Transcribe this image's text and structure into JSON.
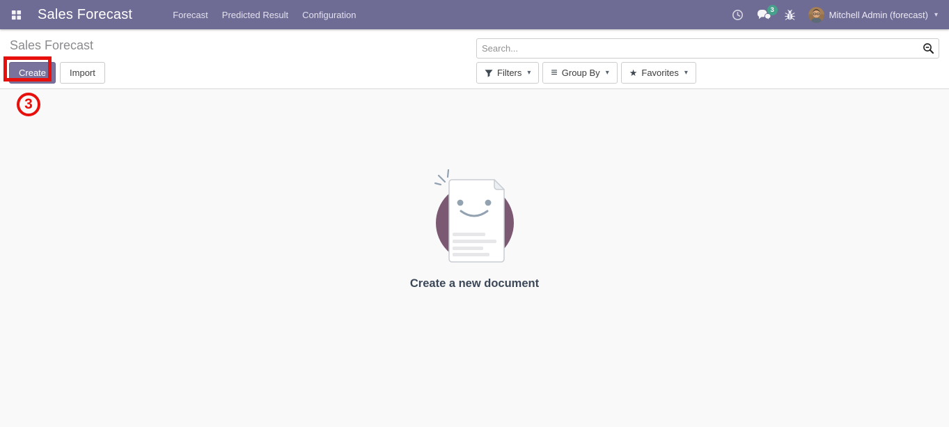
{
  "topbar": {
    "app_title": "Sales Forecast",
    "nav": [
      {
        "label": "Forecast"
      },
      {
        "label": "Predicted Result"
      },
      {
        "label": "Configuration"
      }
    ],
    "systray": {
      "message_count": "3",
      "user_name": "Mitchell Admin (forecast)"
    }
  },
  "control_panel": {
    "breadcrumb": "Sales Forecast",
    "buttons": {
      "create": "Create",
      "import": "Import"
    },
    "search": {
      "placeholder": "Search..."
    },
    "filter_buttons": {
      "filters": "Filters",
      "group_by": "Group By",
      "favorites": "Favorites"
    }
  },
  "content": {
    "empty_state_title": "Create a new document"
  },
  "annotation": {
    "step_number": "3"
  },
  "icons": {
    "caret_down": "▾",
    "star": "★",
    "group_by_glyph": "≡"
  },
  "colors": {
    "topbar_bg": "#6e6b94",
    "primary_button_bg": "#79729d",
    "badge_green": "#47a08c",
    "annotation_red": "#e8100c",
    "plum_circle": "#714b67"
  }
}
